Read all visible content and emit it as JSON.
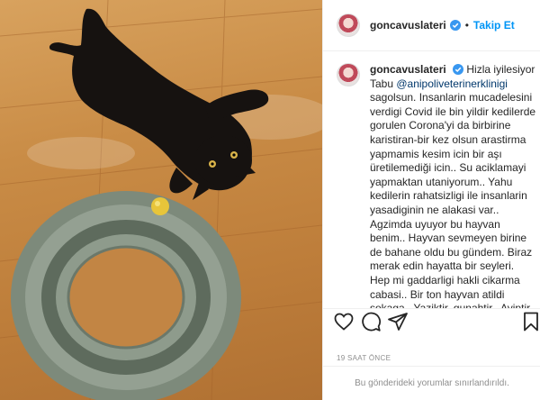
{
  "post": {
    "photo_alt": "black cat on wooden floor with cat toy",
    "username": "goncavuslateri",
    "follow_label": "Takip Et",
    "dot": "•",
    "caption_pre": "Hizla iyilesiyor Tabu ",
    "caption_mention": "@anipoliveterinerklinigi",
    "caption_post": " sagolsun. Insanlarin mucadelesini verdigi Covid ile bin yildir kedilerde gorulen Corona'yi da birbirine karistiran-bir kez olsun arastirma yapmamis kesim icin bir aşı üretilemediği icin.. Su aciklamayi yapmaktan utaniyorum.. Yahu kedilerin rahatsizligi ile insanlarin yasadiginin ne alakasi var.. Agzimda uyuyor bu hayvan benim.. Hayvan sevmeyen birine de bahane oldu bu gündem. Biraz merak edin hayatta bir seyleri. Hep mi gaddarligi hakli cikarma cabasi.. Bir ton hayvan atildi sokaga.. Yaziktir, gunahtir.. Ayiptir.. Bunlar bir yana.. Umursuyor muyum? Asla. Bir iki sevdigim kisi panik olmus Gonca'yi uzmesinler diye onlarin gonlu olsun diye yaziyorum. Yoksa beni ne",
    "timestamp": "19 SAAT ÖNCE",
    "comments_disabled": "Bu gönderideki yorumlar sınırlandırıldı.",
    "icons": {
      "verified": "verified-badge-icon",
      "like": "heart-icon",
      "comment": "comment-icon",
      "share": "share-icon",
      "save": "bookmark-icon"
    },
    "colors": {
      "follow": "#0095f6",
      "verified": "#3897f0",
      "mention": "#00376b",
      "muted": "#8e8e8e"
    }
  }
}
